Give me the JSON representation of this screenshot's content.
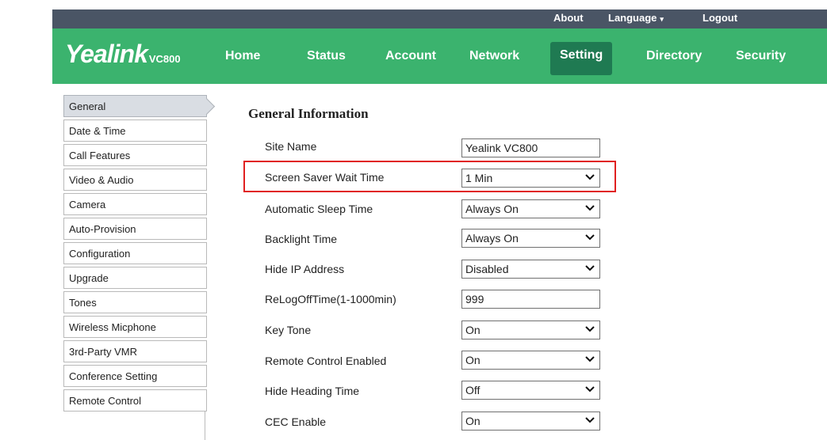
{
  "topbar": {
    "about": "About",
    "language": "Language",
    "language_caret": "▾",
    "logout": "Logout"
  },
  "header": {
    "logo": "Yealink",
    "model": "VC800",
    "nav": [
      "Home",
      "Status",
      "Account",
      "Network",
      "Setting",
      "Directory",
      "Security"
    ],
    "active_nav": "Setting",
    "brand_color": "#3bb36e",
    "active_color": "#1f7a52"
  },
  "sidebar": {
    "items": [
      "General",
      "Date & Time",
      "Call Features",
      "Video & Audio",
      "Camera",
      "Auto-Provision",
      "Configuration",
      "Upgrade",
      "Tones",
      "Wireless Micphone",
      "3rd-Party VMR",
      "Conference Setting",
      "Remote Control"
    ],
    "active": "General"
  },
  "main": {
    "title": "General Information",
    "fields": [
      {
        "label": "Site Name",
        "type": "text",
        "value": "Yealink VC800"
      },
      {
        "label": "Screen Saver Wait Time",
        "type": "select",
        "value": "1 Min"
      },
      {
        "label": "Automatic Sleep Time",
        "type": "select",
        "value": "Always On"
      },
      {
        "label": "Backlight Time",
        "type": "select",
        "value": "Always On"
      },
      {
        "label": "Hide IP Address",
        "type": "select",
        "value": "Disabled"
      },
      {
        "label": "ReLogOffTime(1-1000min)",
        "type": "text",
        "value": "999"
      },
      {
        "label": "Key Tone",
        "type": "select",
        "value": "On"
      },
      {
        "label": "Remote Control Enabled",
        "type": "select",
        "value": "On"
      },
      {
        "label": "Hide Heading Time",
        "type": "select",
        "value": "Off"
      },
      {
        "label": "CEC Enable",
        "type": "select",
        "value": "On"
      }
    ],
    "highlight_color": "#e02020"
  }
}
